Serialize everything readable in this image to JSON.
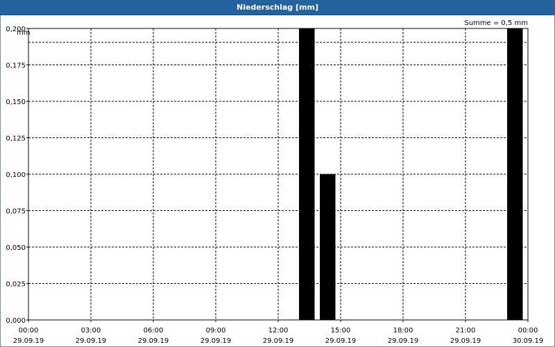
{
  "window": {
    "title": "Niederschlag [mm]"
  },
  "summary": "Summe = 0,5 mm",
  "chart_data": {
    "type": "bar",
    "title": "Niederschlag [mm]",
    "ylabel": "mm",
    "ylim": [
      0,
      0.2
    ],
    "yticks": [
      "0,000",
      "0,025",
      "0,050",
      "0,075",
      "0,100",
      "0,125",
      "0,150",
      "0,175",
      "0,200"
    ],
    "xlim_hours": [
      0,
      24
    ],
    "xticks": [
      {
        "time": "00:00",
        "date": "29.09.19"
      },
      {
        "time": "03:00",
        "date": "29.09.19"
      },
      {
        "time": "06:00",
        "date": "29.09.19"
      },
      {
        "time": "09:00",
        "date": "29.09.19"
      },
      {
        "time": "12:00",
        "date": "29.09.19"
      },
      {
        "time": "15:00",
        "date": "29.09.19"
      },
      {
        "time": "18:00",
        "date": "29.09.19"
      },
      {
        "time": "21:00",
        "date": "29.09.19"
      },
      {
        "time": "00:00",
        "date": "30.09.19"
      }
    ],
    "bars": [
      {
        "start": "29.09.19 13:00",
        "end": "29.09.19 13:45",
        "value": 0.2
      },
      {
        "start": "29.09.19 14:00",
        "end": "29.09.19 14:45",
        "value": 0.1
      },
      {
        "start": "29.09.19 23:00",
        "end": "29.09.19 23:45",
        "value": 0.2
      }
    ],
    "bar_color": "#000000",
    "grid": true
  }
}
